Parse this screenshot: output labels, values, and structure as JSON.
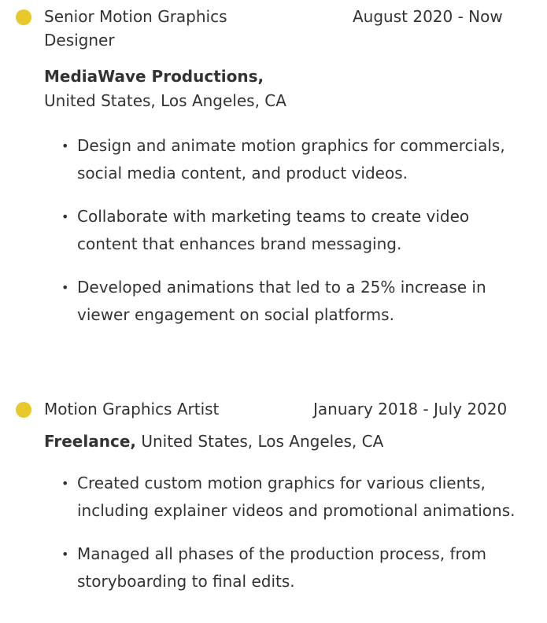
{
  "colors": {
    "accent_dot": "#e8c92b",
    "text": "#333333"
  },
  "jobs": [
    {
      "title": "Senior Motion Graphics Designer",
      "dates": "August 2020 - Now",
      "company": "MediaWave Productions,",
      "location": "United States, Los Angeles, CA",
      "bullets": [
        "Design and animate motion graphics for commercials, social media content, and product videos.",
        "Collaborate with marketing teams to create video content that enhances brand messaging.",
        "Developed animations that led to a 25% increase in viewer engagement on social platforms."
      ]
    },
    {
      "title": "Motion Graphics Artist",
      "dates": "January 2018 - July 2020",
      "company": "Freelance,",
      "location": "United States, Los Angeles, CA",
      "bullets": [
        "Created custom motion graphics for various clients, including explainer videos and promotional animations.",
        "Managed all phases of the production process, from storyboarding to final edits."
      ]
    }
  ]
}
